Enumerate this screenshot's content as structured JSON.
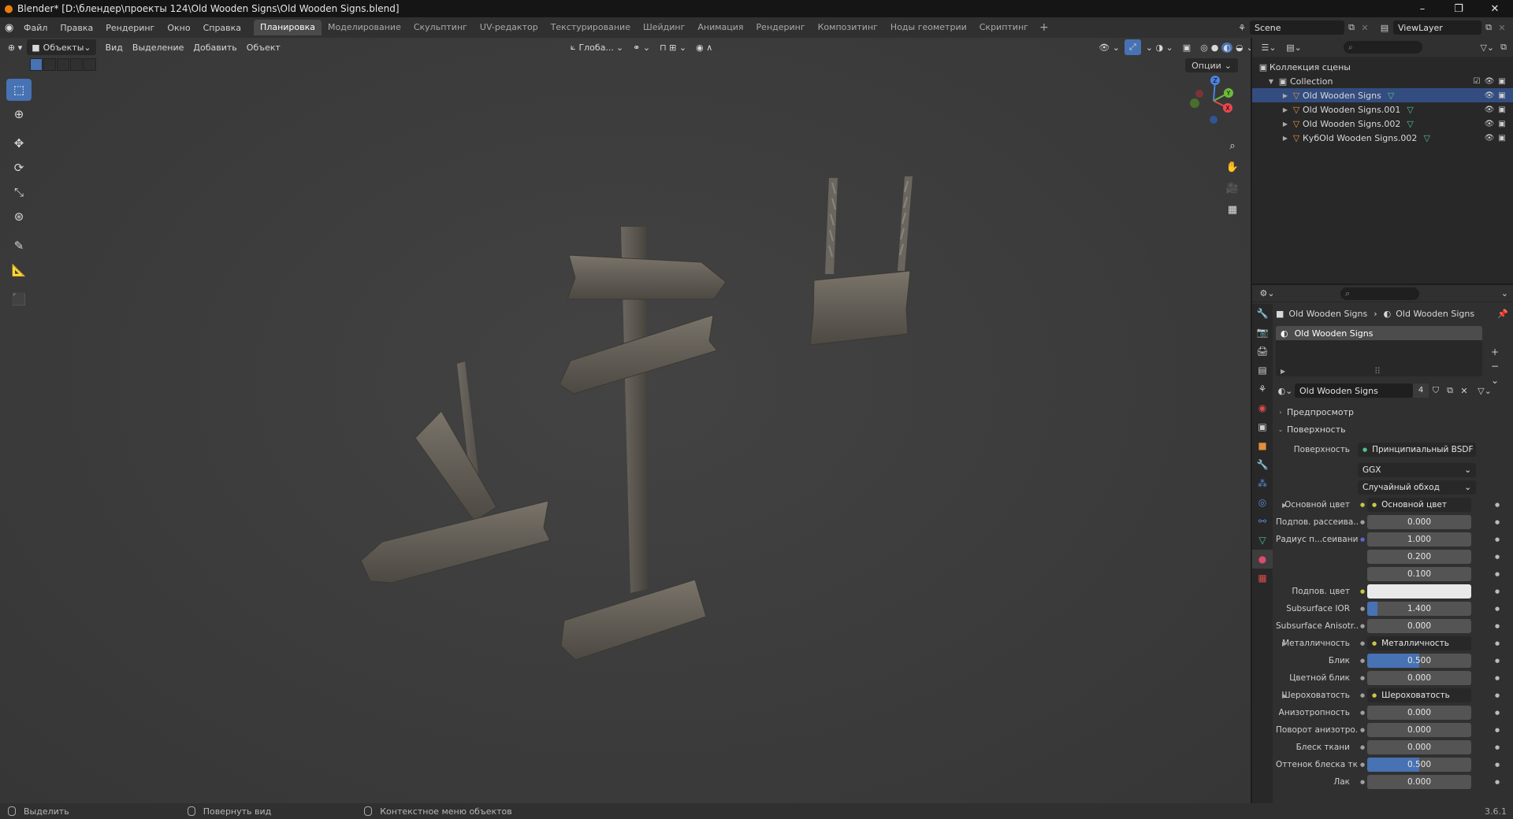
{
  "window": {
    "title": "Blender* [D:\\блендер\\проекты 124\\Old Wooden Signs\\Old Wooden Signs.blend]",
    "controls": [
      "–",
      "❐",
      "✕"
    ]
  },
  "menu": [
    "Файл",
    "Правка",
    "Рендеринг",
    "Окно",
    "Справка"
  ],
  "workspaces": {
    "tabs": [
      "Планировка",
      "Моделирование",
      "Скульптинг",
      "UV-редактор",
      "Текстурирование",
      "Шейдинг",
      "Анимация",
      "Рендеринг",
      "Композитинг",
      "Ноды геометрии",
      "Скриптинг"
    ],
    "active": "Планировка",
    "add": "+"
  },
  "scene": {
    "name": "Scene",
    "view_layer": "ViewLayer"
  },
  "viewport": {
    "mode": "Объекты",
    "menu": [
      "Вид",
      "Выделение",
      "Добавить",
      "Объект"
    ],
    "orientation": "Глоба...",
    "options": "Опции",
    "gizmo_axes": [
      "X",
      "Y",
      "Z"
    ]
  },
  "outliner": {
    "root": "Коллекция сцены",
    "collection": "Collection",
    "objects": [
      "Old Wooden Signs",
      "Old Wooden Signs.001",
      "Old Wooden Signs.002",
      "КубOld Wooden Signs.002"
    ]
  },
  "properties": {
    "breadcrumb": [
      "Old Wooden Signs",
      "Old Wooden Signs"
    ],
    "slot": "Old Wooden Signs",
    "material_name": "Old Wooden Signs",
    "material_users": "4",
    "panels": {
      "preview": "Предпросмотр",
      "surface": "Поверхность"
    },
    "surface_shader_label": "Поверхность",
    "surface_shader": "Принципиальный BSDF",
    "distribution": "GGX",
    "subsurface_method": "Случайный обход",
    "rows": [
      {
        "label": "Основной цвет",
        "value": "Основной цвет",
        "kind": "link",
        "expand": true,
        "socket": "yellow"
      },
      {
        "label": "Подпов. рассеива...",
        "value": "0.000",
        "kind": "num",
        "socket": "grey"
      },
      {
        "label": "Радиус п...сеивания",
        "value": "1.000",
        "kind": "num",
        "socket": "blue"
      },
      {
        "label": "",
        "value": "0.200",
        "kind": "num",
        "socket": "none"
      },
      {
        "label": "",
        "value": "0.100",
        "kind": "num",
        "socket": "none"
      },
      {
        "label": "Подпов. цвет",
        "value": "",
        "kind": "color",
        "socket": "yellow"
      },
      {
        "label": "Subsurface IOR",
        "value": "1.400",
        "kind": "num",
        "socket": "grey",
        "fill": 0.1
      },
      {
        "label": "Subsurface Anisotr...",
        "value": "0.000",
        "kind": "num",
        "socket": "grey"
      },
      {
        "label": "Металличность",
        "value": "Металличность",
        "kind": "link",
        "expand": true,
        "socket": "grey"
      },
      {
        "label": "Блик",
        "value": "0.500",
        "kind": "num",
        "socket": "grey",
        "fill": 0.5
      },
      {
        "label": "Цветной блик",
        "value": "0.000",
        "kind": "num",
        "socket": "grey"
      },
      {
        "label": "Шероховатость",
        "value": "Шероховатость",
        "kind": "link",
        "expand": true,
        "socket": "grey"
      },
      {
        "label": "Анизотропность",
        "value": "0.000",
        "kind": "num",
        "socket": "grey"
      },
      {
        "label": "Поворот анизотро...",
        "value": "0.000",
        "kind": "num",
        "socket": "grey"
      },
      {
        "label": "Блеск ткани",
        "value": "0.000",
        "kind": "num",
        "socket": "grey"
      },
      {
        "label": "Оттенок блеска тк...",
        "value": "0.500",
        "kind": "num",
        "socket": "grey",
        "fill": 0.5
      },
      {
        "label": "Лак",
        "value": "0.000",
        "kind": "num",
        "socket": "grey"
      }
    ]
  },
  "status": {
    "items": [
      "Выделить",
      "Повернуть вид",
      "Контекстное меню объектов"
    ],
    "version": "3.6.1"
  },
  "colors": {
    "accent": "#4772b3",
    "object_icon": "#e0913f",
    "mesh_icon": "#4fc28a"
  }
}
